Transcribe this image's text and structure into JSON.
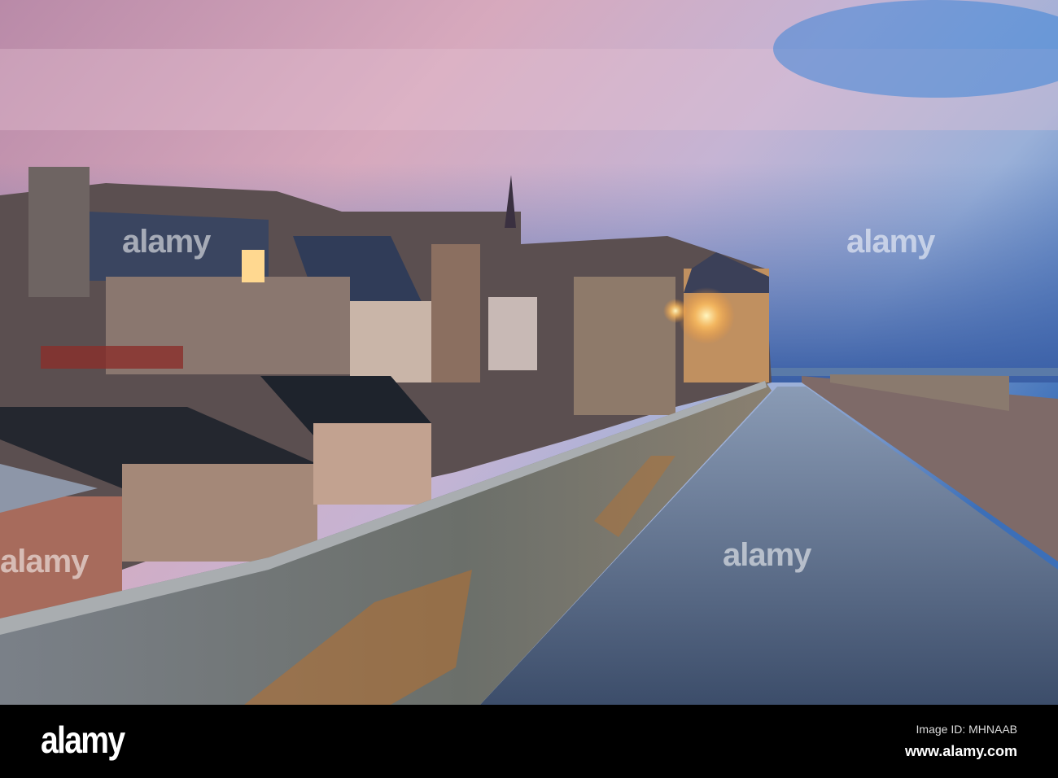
{
  "watermark": "alamy",
  "footer": {
    "logo": "alamy",
    "image_id": "Image ID: MHNAAB",
    "url": "www.alamy.com"
  }
}
